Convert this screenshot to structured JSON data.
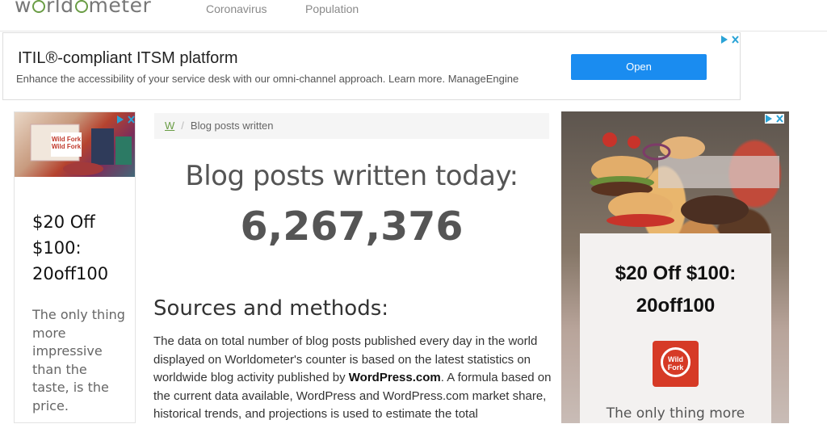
{
  "header": {
    "logo_text_1": "w",
    "logo_text_2": "rld",
    "logo_text_3": "meter",
    "nav": [
      "Coronavirus",
      "Population"
    ]
  },
  "top_ad": {
    "title": "ITIL®-compliant ITSM platform",
    "description": "Enhance the accessibility of your service desk with our omni-channel approach. Learn more. ManageEngine",
    "button": "Open",
    "adchoices_icon": "ad-choices-icon",
    "close_icon": "close-icon"
  },
  "left_ad": {
    "brand_image": "Wild Fork",
    "offer": "$20 Off $100: 20off100",
    "tagline": "The only thing more impressive than the taste, is the price."
  },
  "right_ad": {
    "offer_line1": "$20 Off $100:",
    "offer_line2": "20off100",
    "logo": "Wild Fork",
    "tagline": "The only thing more"
  },
  "breadcrumb": {
    "home": "W",
    "current": "Blog posts written"
  },
  "main": {
    "headline": "Blog posts written today:",
    "counter": "6,267,376",
    "sources_title": "Sources and methods:",
    "paragraph_part1": "The data on total number of blog posts published every day in the world displayed on Worldometer's counter is based on the latest statistics on worldwide blog activity published by ",
    "paragraph_bold": "WordPress.com",
    "paragraph_part2": ". A formula based on the current data available, WordPress and WordPress.com market share, historical trends, and projections is used to estimate the total"
  },
  "colors": {
    "brand_green": "#6a9d45",
    "ad_button": "#1a8cf0",
    "wildfork_red": "#d63a26"
  }
}
